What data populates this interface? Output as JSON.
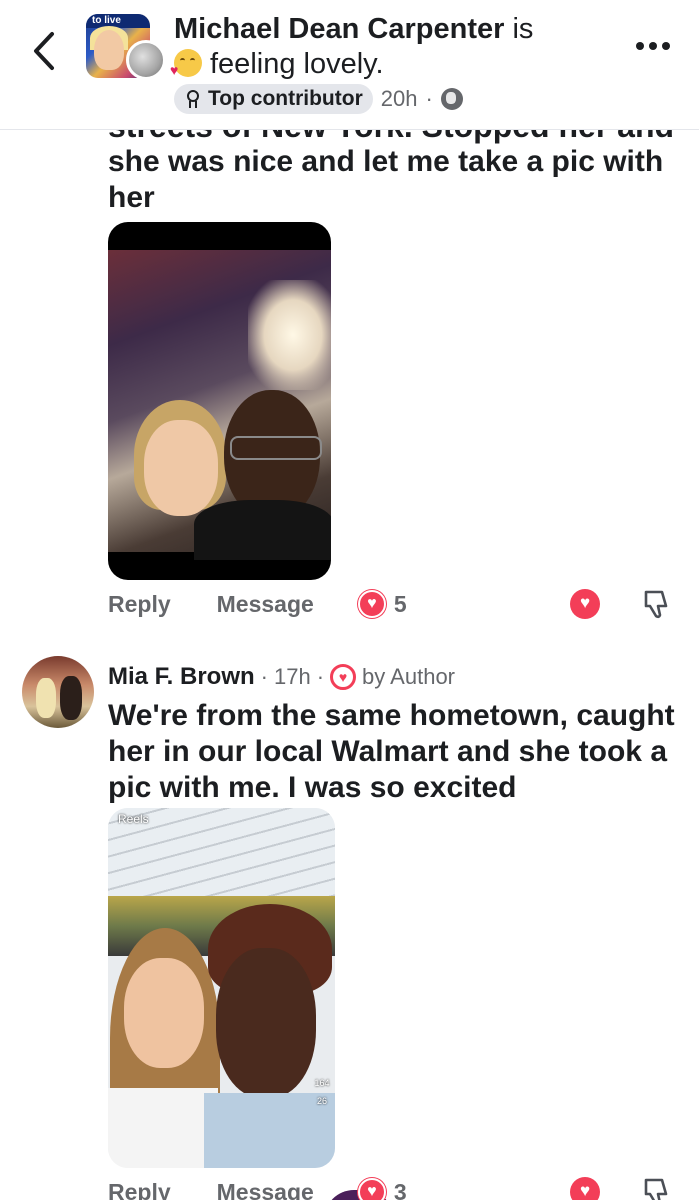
{
  "header": {
    "author_name": "Michael Dean Carpenter",
    "feeling_text": "is",
    "feeling_status": "feeling lovely.",
    "avatar_banner_text": "to live",
    "badge_label": "Top contributor",
    "time": "20h",
    "separator": "·"
  },
  "comment1": {
    "clipped_text": "streets of New York. Stopped her and",
    "text": "she was nice and let me take a pic with her",
    "reply_label": "Reply",
    "message_label": "Message",
    "reaction_count": "5"
  },
  "comment2": {
    "author_name": "Mia F. Brown",
    "time": "17h",
    "separator": "·",
    "author_reaction_label": "by Author",
    "text": "We're from the same hometown, caught her in our local Walmart and she took a pic with me. I was so excited",
    "photo_overlay_label": "Reels",
    "photo_side_count1": "164",
    "photo_side_count2": "26",
    "reply_label": "Reply",
    "message_label": "Message",
    "reaction_count": "3"
  },
  "colors": {
    "love": "#f33e58",
    "secondary_text": "#65676b",
    "primary_text": "#1c1e21",
    "badge_bg": "#e4e6eb"
  },
  "icons": {
    "back": "chevron-left-icon",
    "more": "more-horizontal-icon",
    "badge": "top-contributor-icon",
    "privacy": "globe-icon",
    "love": "heart-icon",
    "dislike": "thumbs-down-icon"
  }
}
